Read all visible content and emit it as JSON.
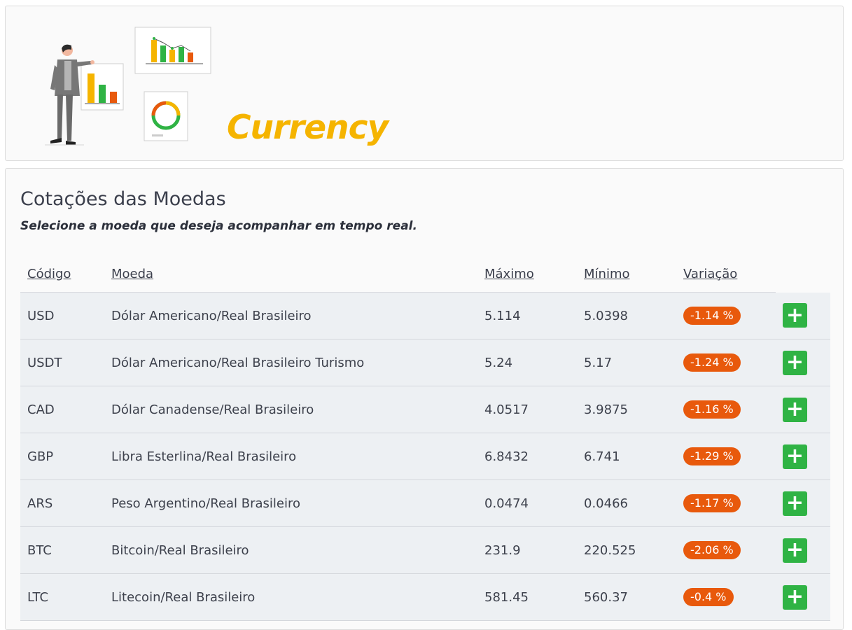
{
  "header": {
    "brand": "Currency"
  },
  "main": {
    "title": "Cotações das Moedas",
    "subtitle": "Selecione a moeda que deseja acompanhar em tempo real.",
    "columns": [
      "Código",
      "Moeda",
      "Máximo",
      "Mínimo",
      "Variação"
    ],
    "add_icon": "plus-icon",
    "badge_color": "#e8590c",
    "add_color": "#2fb344",
    "rows": [
      {
        "code": "USD",
        "name": "Dólar Americano/Real Brasileiro",
        "max": "5.114",
        "min": "5.0398",
        "variation": "-1.14 %"
      },
      {
        "code": "USDT",
        "name": "Dólar Americano/Real Brasileiro Turismo",
        "max": "5.24",
        "min": "5.17",
        "variation": "-1.24 %"
      },
      {
        "code": "CAD",
        "name": "Dólar Canadense/Real Brasileiro",
        "max": "4.0517",
        "min": "3.9875",
        "variation": "-1.16 %"
      },
      {
        "code": "GBP",
        "name": "Libra Esterlina/Real Brasileiro",
        "max": "6.8432",
        "min": "6.741",
        "variation": "-1.29 %"
      },
      {
        "code": "ARS",
        "name": "Peso Argentino/Real Brasileiro",
        "max": "0.0474",
        "min": "0.0466",
        "variation": "-1.17 %"
      },
      {
        "code": "BTC",
        "name": "Bitcoin/Real Brasileiro",
        "max": "231.9",
        "min": "220.525",
        "variation": "-2.06 %"
      },
      {
        "code": "LTC",
        "name": "Litecoin/Real Brasileiro",
        "max": "581.45",
        "min": "560.37",
        "variation": "-0.4 %"
      }
    ]
  }
}
